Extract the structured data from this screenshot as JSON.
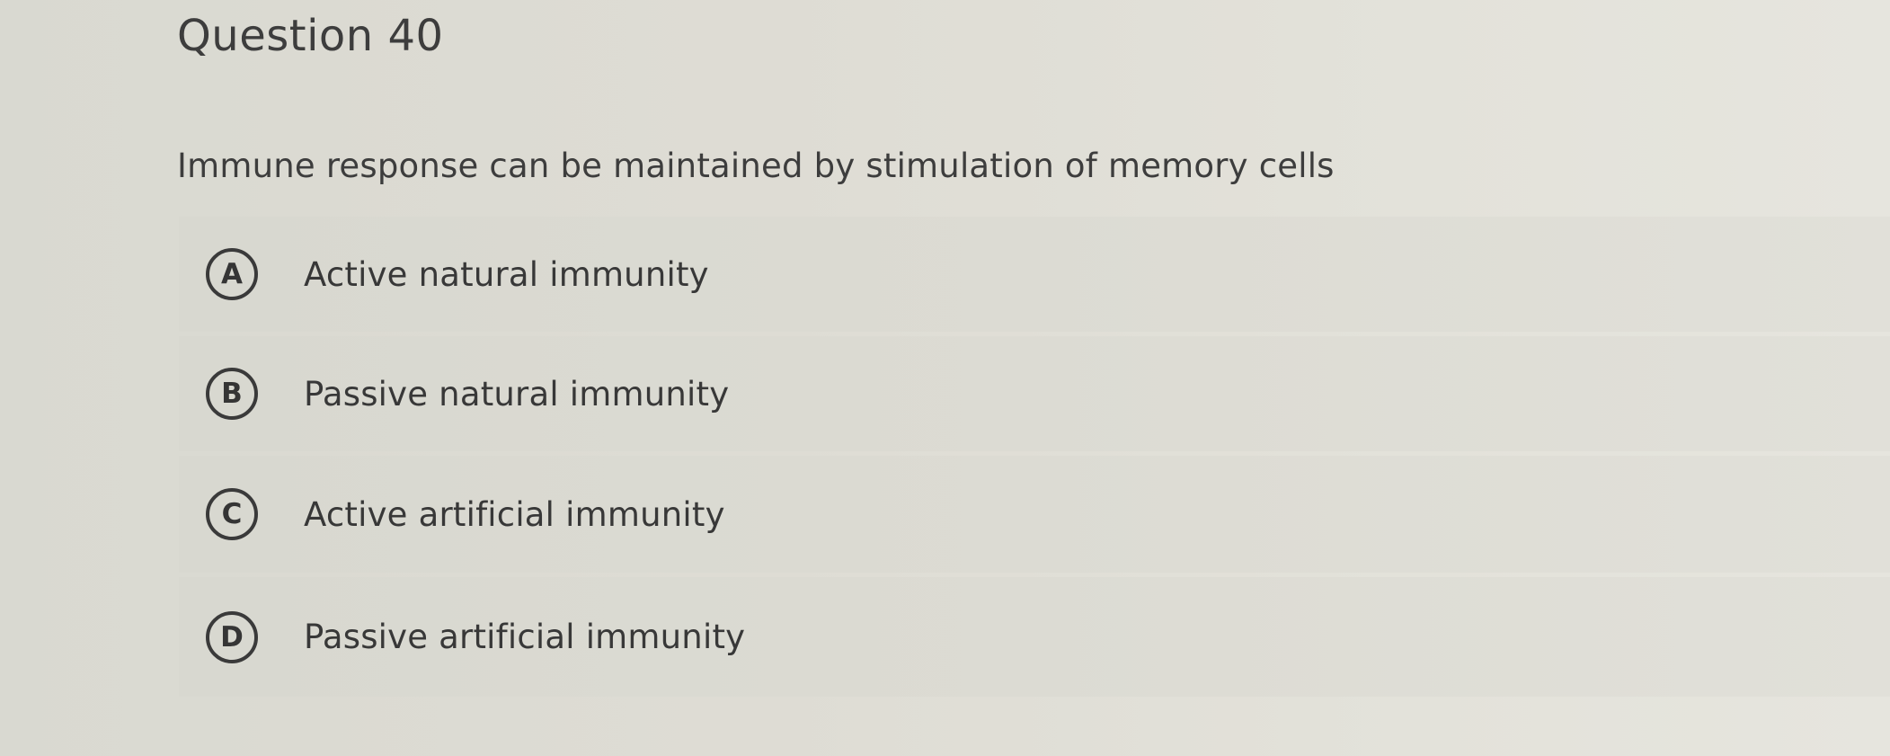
{
  "question": {
    "title": "Question 40",
    "prompt": "Immune response can be maintained by stimulation of memory cells",
    "options": [
      {
        "letter": "A",
        "label": "Active natural immunity"
      },
      {
        "letter": "B",
        "label": "Passive natural immunity"
      },
      {
        "letter": "C",
        "label": "Active artificial immunity"
      },
      {
        "letter": "D",
        "label": "Passive artificial immunity"
      }
    ]
  },
  "colors": {
    "background": "#dedcd4",
    "option_background": "#dcdbd3",
    "text": "#3d3d3d"
  }
}
